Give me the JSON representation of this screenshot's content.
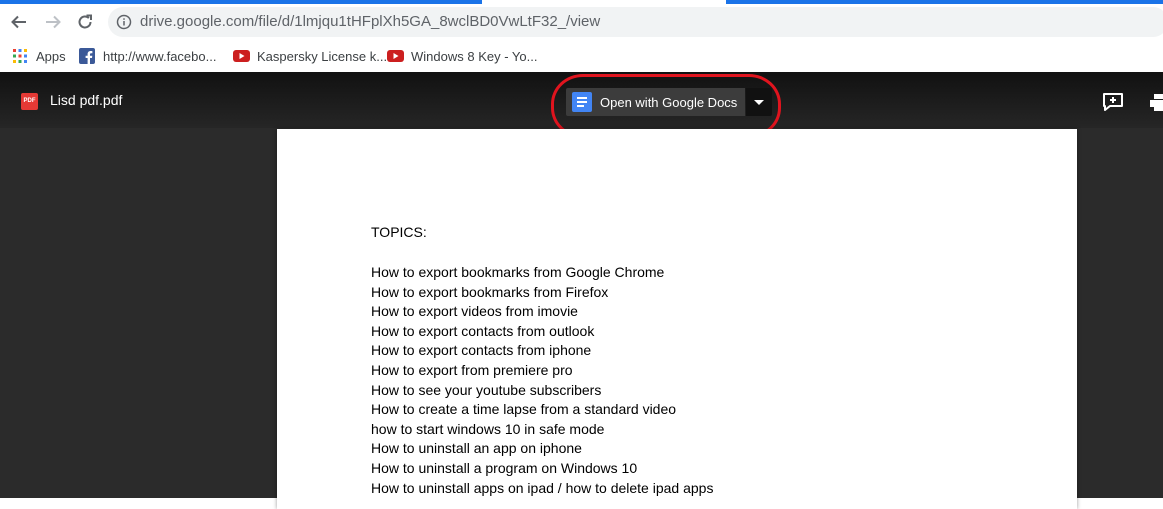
{
  "browser": {
    "url": "drive.google.com/file/d/1lmjqu1tHFplXh5GA_8wclBD0VwLtF32_/view",
    "bookmarks": [
      {
        "label": "Apps",
        "icon": "apps-grid-icon"
      },
      {
        "label": "http://www.facebo...",
        "icon": "facebook-icon"
      },
      {
        "label": "Kaspersky License k...",
        "icon": "youtube-icon"
      },
      {
        "label": "Windows 8 Key - Yo...",
        "icon": "youtube-icon"
      }
    ]
  },
  "viewer": {
    "file_icon_text": "PDF",
    "file_name": "Lisd pdf.pdf",
    "open_with_label": "Open with Google Docs",
    "annotation_color": "#e0141e"
  },
  "document": {
    "heading": "TOPICS:",
    "topics": [
      "How to export bookmarks from Google Chrome",
      "How to export bookmarks from Firefox",
      "How to export videos from imovie",
      "How to export contacts from outlook",
      "How to export contacts from iphone",
      "How to export from premiere pro",
      "How to see your youtube subscribers",
      "How to create a time lapse from a standard video",
      "how to start windows 10 in safe mode",
      "How to uninstall an app on iphone",
      "How to uninstall a program on Windows 10",
      "How to uninstall apps on ipad / how to delete ipad apps"
    ]
  }
}
